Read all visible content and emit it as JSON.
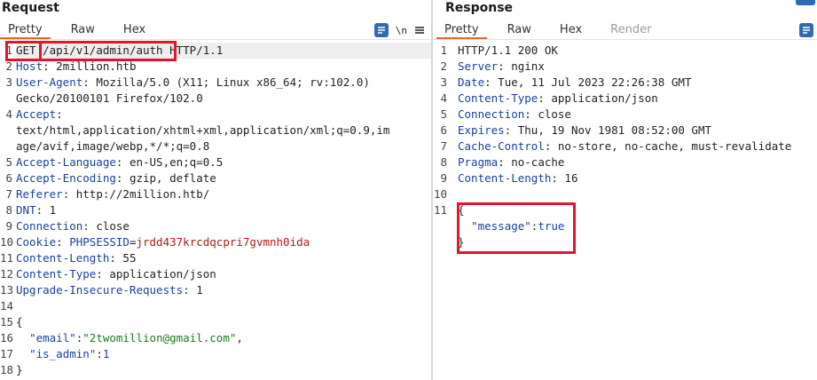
{
  "request": {
    "title": "Request",
    "tabs": [
      {
        "label": "Pretty",
        "active": true
      },
      {
        "label": "Raw",
        "active": false
      },
      {
        "label": "Hex",
        "active": false
      }
    ],
    "tools": {
      "newline_label": "\\n"
    },
    "method": "GET",
    "path": "/api/v1/admin/auth",
    "protocol": "HTTP/1.1",
    "line_numbers": [
      "1",
      "2",
      "3",
      "",
      "4",
      "",
      "",
      "5",
      "6",
      "7",
      "8",
      "9",
      "10",
      "11",
      "12",
      "13",
      "14",
      "15",
      "16",
      "17",
      "18"
    ],
    "headers": {
      "host_key": "Host",
      "host_val": "2million.htb",
      "ua_key": "User-Agent",
      "ua_val_1": "Mozilla/5.0 (X11; Linux x86_64; rv:102.0)",
      "ua_val_2": "Gecko/20100101 Firefox/102.0",
      "accept_key": "Accept",
      "accept_val_1": "text/html,application/xhtml+xml,application/xml;q=0.9,im",
      "accept_val_2": "age/avif,image/webp,*/*;q=0.8",
      "lang_key": "Accept-Language",
      "lang_val": "en-US,en;q=0.5",
      "enc_key": "Accept-Encoding",
      "enc_val": "gzip, deflate",
      "ref_key": "Referer",
      "ref_val": "http://2million.htb/",
      "dnt_key": "DNT",
      "dnt_val": "1",
      "conn_key": "Connection",
      "conn_val": "close",
      "cookie_key": "Cookie",
      "cookie_name": "PHPSESSID",
      "cookie_val": "jrdd437krcdqcpri7gvmnh0ida",
      "cl_key": "Content-Length",
      "cl_val": "55",
      "ct_key": "Content-Type",
      "ct_val": "application/json",
      "uir_key": "Upgrade-Insecure-Requests",
      "uir_val": "1"
    },
    "body": {
      "open": "{",
      "email_key": "\"email\"",
      "email_val": "\"2twomillion@gmail.com\"",
      "admin_key": "\"is_admin\"",
      "admin_val": "1",
      "close": "}"
    }
  },
  "response": {
    "title": "Response",
    "tabs": [
      {
        "label": "Pretty",
        "active": true
      },
      {
        "label": "Raw",
        "active": false
      },
      {
        "label": "Hex",
        "active": false
      },
      {
        "label": "Render",
        "active": false,
        "disabled": true
      }
    ],
    "status_line": "HTTP/1.1 200 OK",
    "headers": {
      "server_key": "Server",
      "server_val": "nginx",
      "date_key": "Date",
      "date_val": "Tue, 11 Jul 2023 22:26:38 GMT",
      "ct_key": "Content-Type",
      "ct_val": "application/json",
      "conn_key": "Connection",
      "conn_val": "close",
      "exp_key": "Expires",
      "exp_val": "Thu, 19 Nov 1981 08:52:00 GMT",
      "cc_key": "Cache-Control",
      "cc_val": "no-store, no-cache, must-revalidate",
      "pragma_key": "Pragma",
      "pragma_val": "no-cache",
      "cl_key": "Content-Length",
      "cl_val": "16"
    },
    "line_numbers": [
      "1",
      "2",
      "3",
      "4",
      "5",
      "6",
      "7",
      "8",
      "9",
      "10",
      "11"
    ],
    "body": {
      "open": "{",
      "msg_key": "\"message\"",
      "msg_val": "true",
      "close": "}"
    }
  },
  "colors": {
    "accent": "#e8652b",
    "highlight_box": "#e0162b",
    "header_key": "#1b3f9c",
    "cookie_value": "#b31717",
    "json_string": "#1f7a1f"
  }
}
